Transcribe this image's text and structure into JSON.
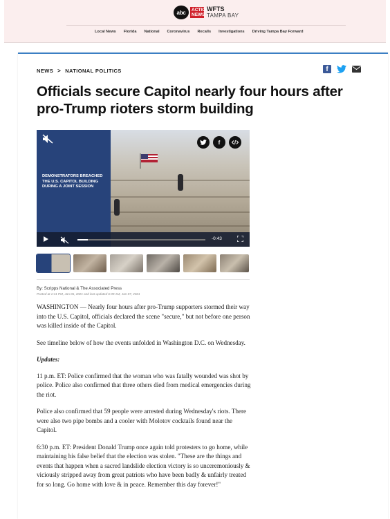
{
  "header": {
    "logo": {
      "abc": "abc",
      "action": "ACTION NEWS",
      "callsign": "WFTS",
      "market": "TAMPA BAY"
    },
    "nav": [
      "Local News",
      "Florida",
      "National",
      "Coronavirus",
      "Recalls",
      "Investigations",
      "Driving Tampa Bay Forward"
    ]
  },
  "article": {
    "breadcrumb": {
      "section": "NEWS",
      "separator": ">",
      "subsection": "NATIONAL POLITICS"
    },
    "headline": "Officials secure Capitol nearly four hours after pro-Trump rioters storm building",
    "video": {
      "caption": "DEMONSTRATORS BREACHED THE U.S. CAPITOL BUILDING DURING A JOINT SESSION",
      "time_remaining": "-0:43",
      "progress": 0.08
    },
    "byline": "By: Scripps National & The Associated Press",
    "posted": "Posted at 1:41 PM, Jan 06, 2021 and last updated 6:39 AM, Jan 07, 2021",
    "paragraphs": [
      "WASHINGTON — Nearly four hours after pro-Trump supporters stormed their way into the U.S. Capitol, officials declared the scene \"secure,\" but not before one person was killed inside of the Capitol.",
      "See timeline below of how the events unfolded in Washington D.C. on Wednesday."
    ],
    "updates_heading": "Updates:",
    "updates": [
      "11 p.m. ET: Police confirmed that the woman who was fatally wounded was shot by police. Police also confirmed that three others died from medical emergencies during the riot.",
      "Police also confirmed that 59 people were arrested during Wednesday's riots. There were also two pipe bombs and a cooler with Molotov cocktails found near the Capitol.",
      "6:30 p.m. ET: President Donald Trump once again told protesters to go home, while maintaining his false belief that the election was stolen. \"These are the things and events that happen when a sacred landslide election victory is so unceremoniously & viciously stripped away from great patriots who have been badly & unfairly treated for so long. Go home with love & in peace. Remember this day forever!\""
    ]
  },
  "colors": {
    "accent_blue": "#3b7fc4",
    "video_panel": "#27437a",
    "header_bg": "#fbeeee",
    "facebook": "#3b5998",
    "twitter": "#1da1f2"
  },
  "icons": [
    "facebook-icon",
    "twitter-icon",
    "mail-icon",
    "mute-icon",
    "play-icon",
    "fullscreen-icon",
    "embed-icon"
  ]
}
